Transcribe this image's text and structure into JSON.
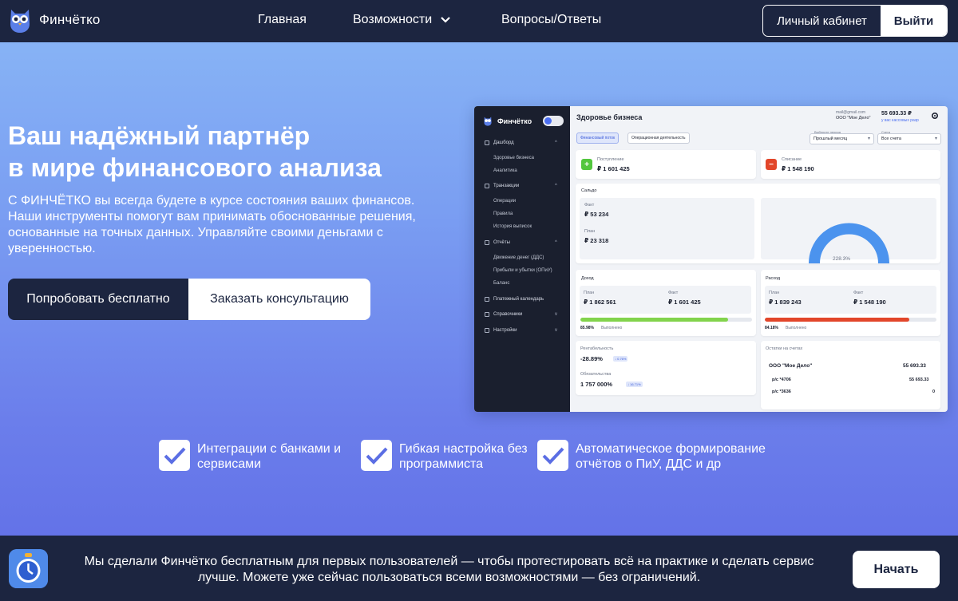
{
  "nav": {
    "brand": "Финчётко",
    "links": [
      "Главная",
      "Возможности",
      "Вопросы/Ответы"
    ],
    "cabinet": "Личный кабинет",
    "logout": "Выйти"
  },
  "hero": {
    "title_line1": "Ваш надёжный партнёр",
    "title_line2": "в мире финансового анализа",
    "description": "С ФИНЧЁТКО вы всегда будете в курсе состояния ваших финансов. Наши инструменты помогут вам принимать обоснованные решения, основанные на точных данных. Управляйте своими деньгами с уверенностью.",
    "btn_try": "Попробовать бесплатно",
    "btn_consult": "Заказать консультацию"
  },
  "dashboard": {
    "brand": "Финчётко",
    "sidebar": {
      "dashboard": "Дашборд",
      "health": "Здоровье бизнеса",
      "analytics": "Аналитика",
      "transactions": "Транзакции",
      "operations": "Операции",
      "rules": "Правила",
      "statements": "История выписок",
      "reports": "Отчёты",
      "cashflow": "Движение денег (ДДС)",
      "pnl": "Прибыли и убытки (ОПиУ)",
      "balance": "Баланс",
      "calendar": "Платежный календарь",
      "directories": "Справочники",
      "settings": "Настройки"
    },
    "title": "Здоровье бизнеса",
    "email": "mail@gmail.com",
    "org": "ООО \"Мое Дело\"",
    "balance": "55 693.33 ₽",
    "balance_sub": "у вас кассовых разр",
    "tab_financial": "Финансовый поток",
    "tab_operational": "Операционная деятельность",
    "period_label": "Выберите период",
    "period_value": "Прошлый месяц",
    "account_label": "Счета",
    "account_value": "Все счета",
    "income_label": "Поступление",
    "income_value": "₽ 1 601 425",
    "expense_label": "Списание",
    "expense_value": "₽ 1 548 190",
    "saldo_title": "Сальдо",
    "fact_label": "Факт",
    "saldo_fact": "₽ 53 234",
    "plan_label": "План",
    "saldo_plan": "₽ 23 318",
    "gauge_value": "228.3%",
    "revenue_title": "Доход",
    "revenue_plan": "₽ 1 862 561",
    "revenue_fact": "₽ 1 601 425",
    "revenue_pct": "85.98%",
    "revenue_progress": 85.98,
    "done_label": "Выполнено",
    "cost_title": "Расход",
    "cost_plan": "₽ 1 839 243",
    "cost_fact": "₽ 1 548 190",
    "cost_pct": "84.18%",
    "cost_progress": 84.18,
    "profitability_label": "Рентабельность",
    "profitability_value": "-28.89%",
    "profitability_badge": "↓ 0.76%",
    "liabilities_label": "Обязательства",
    "liabilities_value": "1 757 000%",
    "liabilities_badge": "↓ 16.71%",
    "accounts_title": "Остатки на счетах",
    "acc_org": "ООО \"Мое Дело\"",
    "acc_org_value": "55 693.33",
    "acc1_name": "р/с *4706",
    "acc1_value": "55 693.33",
    "acc2_name": "р/с *3636",
    "acc2_value": "0"
  },
  "features": [
    "Интеграции с банками и сервисами",
    "Гибкая настройка без программиста",
    "Автоматическое формирование отчётов о ПиУ, ДДС и др"
  ],
  "banner": {
    "text": "Мы сделали Финчётко бесплатным для первых пользователей — чтобы протестировать всё на практике и сделать сервис лучше. Можете уже сейчас пользоваться всеми возможностями — без ограничений.",
    "button": "Начать"
  },
  "colors": {
    "navy": "#1c2540",
    "income_green": "#52c63d",
    "expense_red": "#e2462a",
    "gauge_blue": "#4b93ee",
    "accent": "#4b6ef0"
  },
  "icons": [
    "owl-logo-icon",
    "chevron-down-icon",
    "checkmark-icon",
    "gear-icon",
    "plus-icon",
    "minus-icon",
    "stopwatch-icon"
  ]
}
